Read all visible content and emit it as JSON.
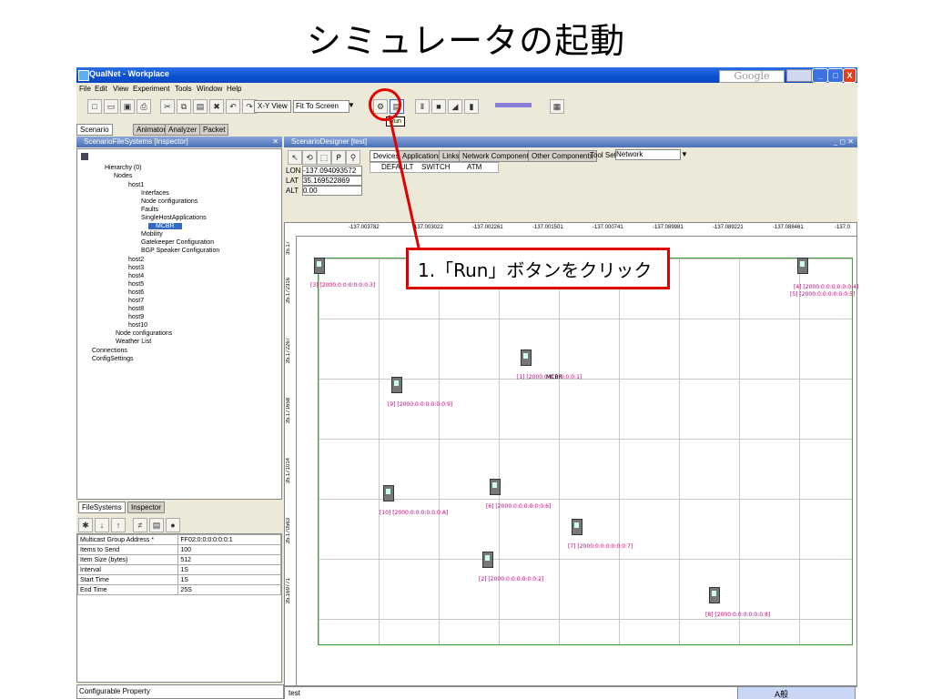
{
  "slide": {
    "title": "シミュレータの起動"
  },
  "window": {
    "title": "QualNet - Workplace",
    "google": "Google",
    "controls": [
      "_",
      "□",
      "X"
    ]
  },
  "menu": [
    "File",
    "Edit",
    "View",
    "Experiment",
    "Tools",
    "Window",
    "Help"
  ],
  "toolbar": {
    "view_mode": "X-Y View",
    "zoom": "Fit To Screen",
    "tooltip": "Run"
  },
  "main_tabs": [
    "Scenario Designer",
    "Animator",
    "Analyzer",
    "Packet Tracer"
  ],
  "left_panel": {
    "title": "ScenarioFileSystems [Inspector]",
    "tree": [
      "Hierarchy (0)",
      "Nodes",
      "host1",
      "Interfaces",
      "Node configurations",
      "Faults",
      "SingleHostApplications",
      "MCBR",
      "Mobility",
      "Gatekeeper Configuration",
      "BGP Speaker Configuration",
      "host2",
      "host3",
      "host4",
      "host5",
      "host6",
      "host7",
      "host8",
      "host9",
      "host10",
      "Node configurations",
      "Weather List",
      "Connections",
      "ConfigSettings"
    ],
    "bottom_tabs": [
      "FileSystems",
      "Inspector"
    ],
    "properties": [
      {
        "name": "Multicast Group Address *",
        "value": "FF02:0:0:0:0:0:0:1"
      },
      {
        "name": "Items to Send",
        "value": "100"
      },
      {
        "name": "Item Size (bytes)",
        "value": "512"
      },
      {
        "name": "Interval",
        "value": "1S"
      },
      {
        "name": "Start Time",
        "value": "1S"
      },
      {
        "name": "End Time",
        "value": "25S"
      }
    ],
    "footer": "Configurable Property"
  },
  "designer": {
    "title": "ScenarioDesigner [test]",
    "lon_label": "LON",
    "lon_value": "-137.094093572",
    "lat_label": "LAT",
    "lat_value": "35.169522869",
    "alt_label": "ALT",
    "alt_value": "0.00",
    "tabs": [
      "Devices",
      "Applications",
      "Links",
      "Network Components",
      "Other Components"
    ],
    "toolset_label": "Tool Set:",
    "toolset_value": "Network",
    "devices": [
      "DEFAULT",
      "SWITCH",
      "ATM"
    ],
    "ruler_x": [
      "-137.003782",
      "-137.003022",
      "-137.002261",
      "-137.001501",
      "-137.000741",
      "-137.089981",
      "-137.089221",
      "-137.088461",
      "-137.0"
    ],
    "ruler_y": [
      "35.17",
      "35.172316",
      "35.172267",
      "35.171658",
      "35.171014",
      "35.170563",
      "35.169771"
    ],
    "status": "test"
  },
  "nodes": [
    {
      "label": "[3] [2000:0:0:0:0:0:0:3]"
    },
    {
      "label": "[4] [2000:0:0:0:0:0:0:4]"
    },
    {
      "label": "[5] [2000:0:0:0:0:0:0:5]"
    },
    {
      "label": "[1] [2000:0:0:0:0:0:0:1]"
    },
    {
      "label": "[9] [2000:0:0:0:0:0:0:9]"
    },
    {
      "label": "[10] [2000:0:0:0:0:0:0:A]"
    },
    {
      "label": "[6] [2000:0:0:0:0:0:0:6]"
    },
    {
      "label": "[7] [2000:0:0:0:0:0:0:7]"
    },
    {
      "label": "[2] [2000:0:0:0:0:0:0:2]"
    },
    {
      "label": "[8] [2000:0:0:0:0:0:0:8]"
    }
  ],
  "app_label": "MCBR",
  "callout": "1.「Run」ボタンをクリック",
  "tray": "A般"
}
